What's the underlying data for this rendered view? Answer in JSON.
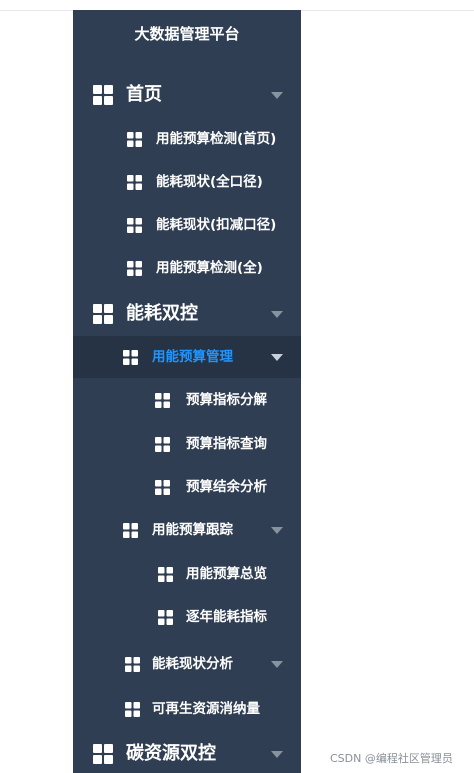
{
  "sidebar": {
    "title": "大数据管理平台",
    "items": [
      {
        "label": "首页",
        "level": 0,
        "expandable": true,
        "active": false
      },
      {
        "label": "用能预算检测(首页)",
        "level": 1,
        "expandable": false,
        "active": false
      },
      {
        "label": "能耗现状(全口径)",
        "level": 1,
        "expandable": false,
        "active": false
      },
      {
        "label": "能耗现状(扣减口径)",
        "level": 1,
        "expandable": false,
        "active": false
      },
      {
        "label": "用能预算检测(全)",
        "level": 1,
        "expandable": false,
        "active": false
      },
      {
        "label": "能耗双控",
        "level": 0,
        "expandable": true,
        "active": false
      },
      {
        "label": "用能预算管理",
        "level": 1,
        "expandable": true,
        "active": true
      },
      {
        "label": "预算指标分解",
        "level": 2,
        "expandable": false,
        "active": false
      },
      {
        "label": "预算指标查询",
        "level": 2,
        "expandable": false,
        "active": false
      },
      {
        "label": "预算结余分析",
        "level": 2,
        "expandable": false,
        "active": false
      },
      {
        "label": "用能预算跟踪",
        "level": 1,
        "expandable": true,
        "active": false
      },
      {
        "label": "用能预算总览",
        "level": 2,
        "expandable": false,
        "active": false
      },
      {
        "label": "逐年能耗指标",
        "level": 2,
        "expandable": false,
        "active": false
      },
      {
        "label": "能耗现状分析",
        "level": 1,
        "expandable": true,
        "active": false
      },
      {
        "label": "可再生资源消纳量",
        "level": 1,
        "expandable": false,
        "active": false
      },
      {
        "label": "碳资源双控",
        "level": 0,
        "expandable": true,
        "active": false
      }
    ]
  },
  "watermark": "CSDN @编程社区管理员",
  "icon": "grid-icon",
  "colors": {
    "sidebar_bg": "#2f3e52",
    "active_bg": "#263345",
    "active_text": "#1e95ff",
    "text": "#ffffff",
    "arrow": "#8893a2"
  }
}
